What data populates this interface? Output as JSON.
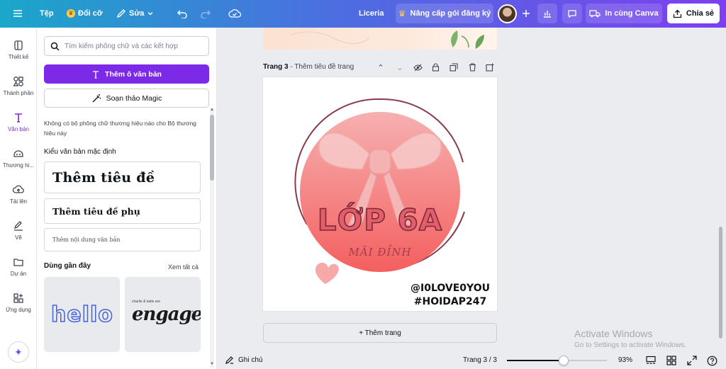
{
  "topbar": {
    "menu_icon": "menu-icon",
    "file_label": "Tệp",
    "resize_label": "Đổi cỡ",
    "edit_label": "Sửa",
    "user_name": "Liceria",
    "upgrade_label": "Nâng cấp gói đăng ký",
    "print_label": "In cùng Canva",
    "share_label": "Chia sẻ",
    "accent_color": "#7d2ae8"
  },
  "rail": {
    "items": [
      {
        "label": "Thiết kế",
        "icon": "design-icon"
      },
      {
        "label": "Thành phần",
        "icon": "elements-icon"
      },
      {
        "label": "Văn bản",
        "icon": "text-icon"
      },
      {
        "label": "Thương hi...",
        "icon": "brand-icon"
      },
      {
        "label": "Tải lên",
        "icon": "upload-icon"
      },
      {
        "label": "Vẽ",
        "icon": "draw-icon"
      },
      {
        "label": "Dự án",
        "icon": "projects-icon"
      },
      {
        "label": "Ứng dụng",
        "icon": "apps-icon"
      }
    ]
  },
  "panel": {
    "search_placeholder": "Tìm kiếm phông chữ và các kết hợp",
    "add_textbox_label": "Thêm ô văn bản",
    "magic_write_label": "Soạn thảo Magic",
    "brand_font_info": "Không có bộ phông chữ thương hiệu nào cho Bộ thương hiệu này",
    "default_styles_title": "Kiểu văn bản mặc định",
    "heading_label": "Thêm tiêu đề",
    "subheading_label": "Thêm tiêu đề phụ",
    "body_label": "Thêm nội dung văn bản",
    "recent_title": "Dùng gần đây",
    "see_all_label": "Xem tất cả",
    "recent_items": [
      {
        "text": "hello"
      },
      {
        "small": "charlie & katie are",
        "text": "engaged!"
      }
    ]
  },
  "canvas": {
    "page_label": "Trang 3",
    "page_title_placeholder": "Thêm tiêu đề trang",
    "design": {
      "main_text": "LỚP 6A",
      "sub_text": "MÃI ĐỈNH",
      "handle": "@I0LOVE0YOU",
      "hashtag": "#HOIDAP247",
      "circle_top_color": "#f6b0b0",
      "circle_bottom_color": "#f4605f",
      "ring_color": "#8a3a4a"
    },
    "add_page_label": "+ Thêm trang"
  },
  "watermark": {
    "line1": "Activate Windows",
    "line2": "Go to Settings to activate Windows."
  },
  "bottombar": {
    "notes_label": "Ghi chú",
    "page_counter": "Trang 3 / 3",
    "zoom_label": "93%",
    "zoom_level": 0.57
  }
}
